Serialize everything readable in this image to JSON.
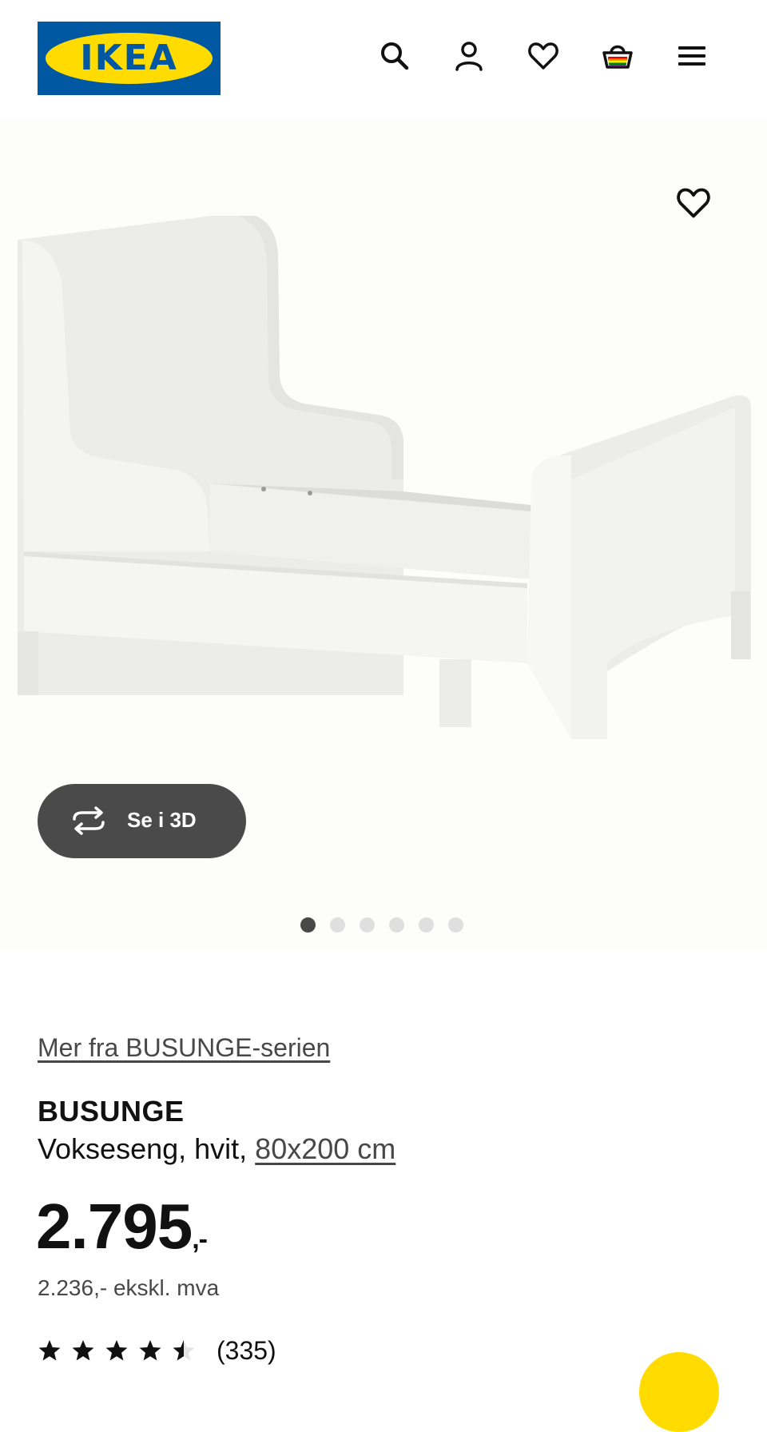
{
  "header": {
    "logo_text": "IKEA",
    "logo_reg": "®",
    "icons": [
      "search-icon",
      "user-icon",
      "heart-icon",
      "basket-icon",
      "menu-icon"
    ]
  },
  "gallery": {
    "view_3d_label": "Se i 3D",
    "active_image": 1,
    "image_count": 6
  },
  "product": {
    "series_link": "Mer fra BUSUNGE-serien",
    "name": "BUSUNGE",
    "description": "Vokseseng, hvit, ",
    "size": "80x200 cm",
    "price": "2.795",
    "price_suffix": ",-",
    "price_ex_vat": "2.236,- ekskl. mva",
    "rating": 4.5,
    "review_count": "(335)"
  },
  "colors": {
    "brand_blue": "#0058a3",
    "brand_yellow": "#ffdb00",
    "button_dark": "#4a4a4a"
  }
}
